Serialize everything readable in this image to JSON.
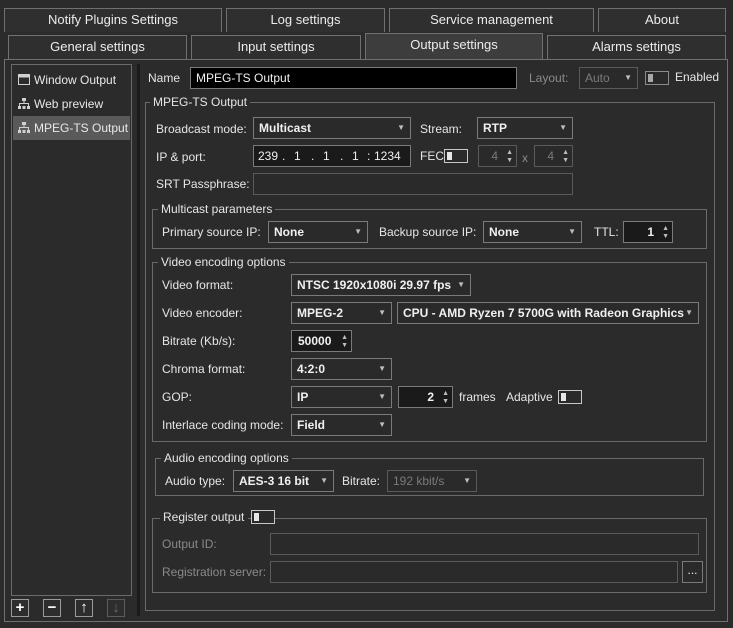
{
  "tabs_top": [
    "Notify Plugins Settings",
    "Log settings",
    "Service management",
    "About"
  ],
  "tabs_bottom": [
    "General settings",
    "Input settings",
    "Output settings",
    "Alarms settings"
  ],
  "active_tab": "Output settings",
  "outputs": [
    "Window Output",
    "Web preview",
    "MPEG-TS Output"
  ],
  "bottom_buttons": [
    "+",
    "−",
    "↑",
    "↓"
  ],
  "name_label": "Name",
  "name_value": "MPEG-TS Output",
  "layout_label": "Layout:",
  "layout_value": "Auto",
  "enabled_label": "Enabled",
  "group_main": "MPEG-TS Output",
  "broadcast_mode_label": "Broadcast mode:",
  "broadcast_mode_value": "Multicast",
  "stream_label": "Stream:",
  "stream_value": "RTP",
  "ip_port_label": "IP & port:",
  "ip_octets": [
    "239",
    "1",
    "1",
    "1"
  ],
  "ip_separator": ".",
  "port_separator": ":",
  "port": "1234",
  "fec_label": "FEC",
  "fec_cols": "4",
  "fec_x": "x",
  "fec_rows": "4",
  "srt_label": "SRT Passphrase:",
  "multicast_group": "Multicast parameters",
  "primary_source_label": "Primary source IP:",
  "primary_source_value": "None",
  "backup_source_label": "Backup source IP:",
  "backup_source_value": "None",
  "ttl_label": "TTL:",
  "ttl_value": "1",
  "video_group": "Video encoding options",
  "video_format_label": "Video format:",
  "video_format_value": "NTSC 1920x1080i 29.97 fps",
  "video_encoder_label": "Video encoder:",
  "video_encoder_value": "MPEG-2",
  "encoder_device_value": "CPU - AMD Ryzen 7 5700G with Radeon Graphics",
  "bitrate_label": "Bitrate (Kb/s):",
  "bitrate_value": "50000",
  "chroma_label": "Chroma format:",
  "chroma_value": "4:2:0",
  "gop_label": "GOP:",
  "gop_value": "IP",
  "gop_frames_value": "2",
  "frames_label": "frames",
  "adaptive_label": "Adaptive",
  "interlace_label": "Interlace coding mode:",
  "interlace_value": "Field",
  "audio_group": "Audio encoding options",
  "audio_type_label": "Audio type:",
  "audio_type_value": "AES-3 16 bit",
  "audio_bitrate_label": "Bitrate:",
  "audio_bitrate_value": "192 kbit/s",
  "register_label": "Register output",
  "output_id_label": "Output ID:",
  "registration_server_label": "Registration server:",
  "browse_label": "..."
}
